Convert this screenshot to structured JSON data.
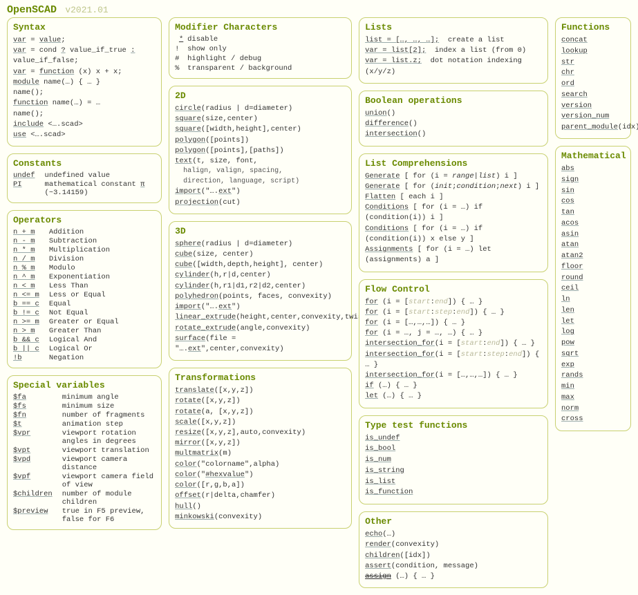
{
  "header": {
    "title": "OpenSCAD",
    "version": "v2021.01"
  },
  "syntax": {
    "title": "Syntax",
    "lines": [
      {
        "html": "<span class='lnk'>var</span> = <span class='lnk'>value</span>;"
      },
      {
        "html": "<span class='lnk'>var</span> = cond <span class='lnk'>?</span> value_if_true <span class='lnk'>:</span> value_if_false;"
      },
      {
        "html": "<span class='lnk'>var</span> = <span class='lnk'>function</span> (x) x + x;"
      },
      {
        "html": "<span class='lnk'>module</span> name(…) { … }<br>name();"
      },
      {
        "html": "<span class='lnk'>function</span> name(…) = …<br>name();"
      },
      {
        "html": "<span class='lnk'>include</span> &lt;….scad&gt;"
      },
      {
        "html": "<span class='lnk'>use</span> &lt;….scad&gt;"
      }
    ]
  },
  "constants": {
    "title": "Constants",
    "rows": [
      {
        "k": "undef",
        "v": "undefined value"
      },
      {
        "k": "PI",
        "v": "mathematical constant <span class='lnk'>π</span> (~3.14159)"
      }
    ]
  },
  "operators": {
    "title": "Operators",
    "rows": [
      {
        "k": "n + m",
        "v": "Addition"
      },
      {
        "k": "n - m",
        "v": "Subtraction"
      },
      {
        "k": "n * m",
        "v": "Multiplication"
      },
      {
        "k": "n / m",
        "v": "Division"
      },
      {
        "k": "n % m",
        "v": "Modulo"
      },
      {
        "k": "n ^ m",
        "v": "Exponentiation"
      },
      {
        "k": "n < m",
        "v": "Less Than"
      },
      {
        "k": "n <= m",
        "v": "Less or Equal"
      },
      {
        "k": "b == c",
        "v": "Equal"
      },
      {
        "k": "b != c",
        "v": "Not Equal"
      },
      {
        "k": "n >= m",
        "v": "Greater or Equal"
      },
      {
        "k": "n > m",
        "v": "Greater Than"
      },
      {
        "k": "b && c",
        "v": "Logical And"
      },
      {
        "k": "b || c",
        "v": "Logical Or"
      },
      {
        "k": "!b",
        "v": "Negation"
      }
    ]
  },
  "special": {
    "title": "Special variables",
    "rows": [
      {
        "k": "$fa",
        "v": "minimum angle"
      },
      {
        "k": "$fs",
        "v": "minimum size"
      },
      {
        "k": "$fn",
        "v": "number of fragments"
      },
      {
        "k": "$t",
        "v": "animation step"
      },
      {
        "k": "$vpr",
        "v": "viewport rotation angles in degrees"
      },
      {
        "k": "$vpt",
        "v": "viewport translation"
      },
      {
        "k": "$vpd",
        "v": "viewport camera distance"
      },
      {
        "k": "$vpf",
        "v": "viewport camera field of view"
      },
      {
        "k": "$children",
        "v": "number of module children"
      },
      {
        "k": "$preview",
        "v": "true in F5 preview, false for F6"
      }
    ]
  },
  "modchars": {
    "title": "Modifier Characters",
    "rows": [
      {
        "k": "*",
        "v": "disable"
      },
      {
        "k": "!",
        "v": "show only"
      },
      {
        "k": "#",
        "v": "highlight / debug"
      },
      {
        "k": "%",
        "v": "transparent / background"
      }
    ]
  },
  "d2": {
    "title": "2D",
    "lines": [
      {
        "html": "<span class='lnk'>circle</span>(radius | d=diameter)"
      },
      {
        "html": "<span class='lnk'>square</span>(size,center)"
      },
      {
        "html": "<span class='lnk'>square</span>([width,height],center)"
      },
      {
        "html": "<span class='lnk'>polygon</span>([points])"
      },
      {
        "html": "<span class='lnk'>polygon</span>([points],[paths])"
      },
      {
        "html": "<span class='lnk'>text</span>(t, size, font,<span class='sub'>halign, valign, spacing,<br>direction, language, script)</span>"
      },
      {
        "html": "<span class='lnk'>import</span>(\"….<span class='lnk'>ext</span>\")"
      },
      {
        "html": "<span class='lnk'>projection</span>(cut)"
      }
    ]
  },
  "d3": {
    "title": "3D",
    "lines": [
      {
        "html": "<span class='lnk'>sphere</span>(radius | d=diameter)"
      },
      {
        "html": "<span class='lnk'>cube</span>(size, center)"
      },
      {
        "html": "<span class='lnk'>cube</span>([width,depth,height], center)"
      },
      {
        "html": "<span class='lnk'>cylinder</span>(h,r|d,center)"
      },
      {
        "html": "<span class='lnk'>cylinder</span>(h,r1|d1,r2|d2,center)"
      },
      {
        "html": "<span class='lnk'>polyhedron</span>(points, faces, convexity)"
      },
      {
        "html": "<span class='lnk'>import</span>(\"….<span class='lnk'>ext</span>\")"
      },
      {
        "html": "<span class='lnk'>linear_extrude</span>(height,center,convexity,twist,slices)"
      },
      {
        "html": "<span class='lnk'>rotate_extrude</span>(angle,convexity)"
      },
      {
        "html": "<span class='lnk'>surface</span>(file = \"….<span class='lnk'>ext</span>\",center,convexity)"
      }
    ]
  },
  "trans": {
    "title": "Transformations",
    "lines": [
      {
        "html": "<span class='lnk'>translate</span>([x,y,z])"
      },
      {
        "html": "<span class='lnk'>rotate</span>([x,y,z])"
      },
      {
        "html": "<span class='lnk'>rotate</span>(a, [x,y,z])"
      },
      {
        "html": "<span class='lnk'>scale</span>([x,y,z])"
      },
      {
        "html": "<span class='lnk'>resize</span>([x,y,z],auto,convexity)"
      },
      {
        "html": "<span class='lnk'>mirror</span>([x,y,z])"
      },
      {
        "html": "<span class='lnk'>multmatrix</span>(m)"
      },
      {
        "html": "<span class='lnk'>color</span>(\"colorname\",alpha)"
      },
      {
        "html": "<span class='lnk'>color</span>(\"<span class='lnk'>#hexvalue</span>\")"
      },
      {
        "html": "<span class='lnk'>color</span>([r,g,b,a])"
      },
      {
        "html": "<span class='lnk'>offset</span>(r|delta,chamfer)"
      },
      {
        "html": "<span class='lnk'>hull</span>()"
      },
      {
        "html": "<span class='lnk'>minkowski</span>(convexity)"
      }
    ]
  },
  "lists": {
    "title": "Lists",
    "lines": [
      {
        "html": "<span class='lnk'>list = […, …, …];</span>&nbsp;&nbsp;create a list"
      },
      {
        "html": "<span class='lnk'>var = list[2];</span>&nbsp;&nbsp;index a list (from 0)"
      },
      {
        "html": "<span class='lnk'>var = list.z;</span>&nbsp;&nbsp;dot notation indexing (x/y/z)"
      }
    ]
  },
  "bool": {
    "title": "Boolean operations",
    "lines": [
      {
        "html": "<span class='lnk'>union</span>()"
      },
      {
        "html": "<span class='lnk'>difference</span>()"
      },
      {
        "html": "<span class='lnk'>intersection</span>()"
      }
    ]
  },
  "lc": {
    "title": "List Comprehensions",
    "lines": [
      {
        "html": "<span class='lnk'>Generate</span> [ for (i = <i>range</i>|<i>list</i>) i ]"
      },
      {
        "html": "<span class='lnk'>Generate</span> [ for (<i>init</i>;<i>condition</i>;<i>next</i>) i ]"
      },
      {
        "html": "<span class='lnk'>Flatten</span> [ each i ]"
      },
      {
        "html": "<span class='lnk'>Conditions</span> [ for (i = …) if (condition(i)) i ]"
      },
      {
        "html": "<span class='lnk'>Conditions</span> [ for (i = …) if (condition(i)) x else y ]"
      },
      {
        "html": "<span class='lnk'>Assignments</span> [ for (i = …) let (assignments) a ]"
      }
    ]
  },
  "flow": {
    "title": "Flow Control",
    "lines": [
      {
        "html": "<span class='lnk'>for</span> (i = [<span class='grey'>start</span>:<span class='grey'>end</span>]) { … }"
      },
      {
        "html": "<span class='lnk'>for</span> (i = [<span class='grey'>start</span>:<span class='grey'>step</span>:<span class='grey'>end</span>]) { … }"
      },
      {
        "html": "<span class='lnk'>for</span> (i = […,…,…]) { … }"
      },
      {
        "html": "<span class='lnk'>for</span> (i = …, j = …, …) { … }"
      },
      {
        "html": "<span class='lnk'>intersection_for</span>(i = [<span class='grey'>start</span>:<span class='grey'>end</span>]) { … }"
      },
      {
        "html": "<span class='lnk'>intersection_for</span>(i = [<span class='grey'>start</span>:<span class='grey'>step</span>:<span class='grey'>end</span>]) { … }"
      },
      {
        "html": "<span class='lnk'>intersection_for</span>(i = […,…,…]) { … }"
      },
      {
        "html": "<span class='lnk'>if</span> (…) { … }"
      },
      {
        "html": "<span class='lnk'>let</span> (…) { … }"
      }
    ]
  },
  "typetest": {
    "title": "Type test functions",
    "items": [
      "is_undef",
      "is_bool",
      "is_num",
      "is_string",
      "is_list",
      "is_function"
    ]
  },
  "other": {
    "title": "Other",
    "lines": [
      {
        "html": "<span class='lnk'>echo</span>(…)"
      },
      {
        "html": "<span class='lnk'>render</span>(convexity)"
      },
      {
        "html": "<span class='lnk'>children</span>([idx])"
      },
      {
        "html": "<span class='lnk'>assert</span>(condition, message)"
      },
      {
        "html": "<span class='lnk'>assign</span> (…) { … }",
        "strike": true
      }
    ]
  },
  "funcs": {
    "title": "Functions",
    "items": [
      "concat",
      "lookup",
      "str",
      "chr",
      "ord",
      "search",
      "version",
      "version_num"
    ],
    "last": {
      "name": "parent_module",
      "arg": "(idx)"
    }
  },
  "math": {
    "title": "Mathematical",
    "items": [
      "abs",
      "sign",
      "sin",
      "cos",
      "tan",
      "acos",
      "asin",
      "atan",
      "atan2",
      "floor",
      "round",
      "ceil",
      "ln",
      "len",
      "let",
      "log",
      "pow",
      "sqrt",
      "exp",
      "rands",
      "min",
      "max",
      "norm",
      "cross"
    ]
  }
}
